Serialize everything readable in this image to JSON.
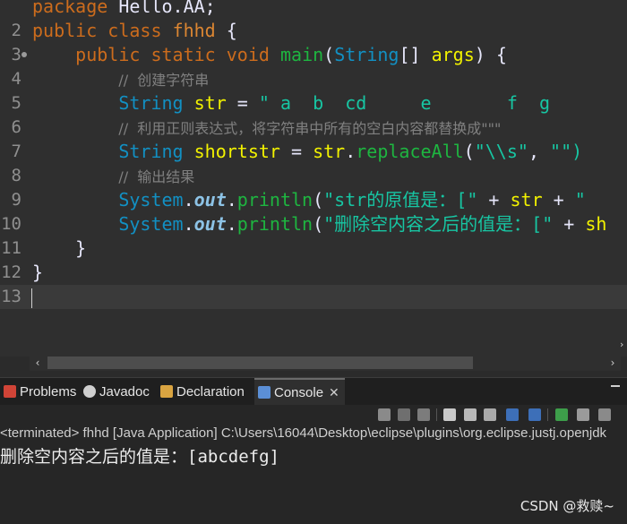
{
  "editor": {
    "lines": [
      {
        "num": "",
        "tokens": [
          {
            "c": "kw",
            "t": "package"
          },
          {
            "c": "plain",
            "t": " Hello.AA;"
          }
        ]
      },
      {
        "num": "2",
        "tokens": [
          {
            "c": "kw",
            "t": "public"
          },
          {
            "c": "plain",
            "t": " "
          },
          {
            "c": "kw",
            "t": "class"
          },
          {
            "c": "plain",
            "t": " "
          },
          {
            "c": "cls",
            "t": "fhhd"
          },
          {
            "c": "plain",
            "t": " {"
          }
        ]
      },
      {
        "num": "3",
        "marker": true,
        "tokens": [
          {
            "c": "plain",
            "t": "    "
          },
          {
            "c": "kw",
            "t": "public"
          },
          {
            "c": "plain",
            "t": " "
          },
          {
            "c": "kw",
            "t": "static"
          },
          {
            "c": "plain",
            "t": " "
          },
          {
            "c": "kw",
            "t": "void"
          },
          {
            "c": "plain",
            "t": " "
          },
          {
            "c": "fn",
            "t": "main"
          },
          {
            "c": "plain",
            "t": "("
          },
          {
            "c": "type",
            "t": "String"
          },
          {
            "c": "plain",
            "t": "[] "
          },
          {
            "c": "var",
            "t": "args"
          },
          {
            "c": "plain",
            "t": ") {"
          }
        ]
      },
      {
        "num": "4",
        "tokens": [
          {
            "c": "plain",
            "t": "        "
          },
          {
            "c": "cmt",
            "t": "//  创建字符串"
          }
        ]
      },
      {
        "num": "5",
        "tokens": [
          {
            "c": "plain",
            "t": "        "
          },
          {
            "c": "type",
            "t": "String"
          },
          {
            "c": "plain",
            "t": " "
          },
          {
            "c": "var",
            "t": "str"
          },
          {
            "c": "plain",
            "t": " = "
          },
          {
            "c": "str",
            "t": "\" a  b  cd     e       f  g"
          }
        ]
      },
      {
        "num": "6",
        "tokens": [
          {
            "c": "plain",
            "t": "        "
          },
          {
            "c": "cmt",
            "t": "//  利用正则表达式，将字符串中所有的空白内容都替换成\"\"\""
          }
        ]
      },
      {
        "num": "7",
        "tokens": [
          {
            "c": "plain",
            "t": "        "
          },
          {
            "c": "type",
            "t": "String"
          },
          {
            "c": "plain",
            "t": " "
          },
          {
            "c": "var",
            "t": "shortstr"
          },
          {
            "c": "plain",
            "t": " = "
          },
          {
            "c": "var",
            "t": "str"
          },
          {
            "c": "plain",
            "t": "."
          },
          {
            "c": "fn",
            "t": "replaceAll"
          },
          {
            "c": "plain",
            "t": "("
          },
          {
            "c": "str",
            "t": "\"\\\\s\""
          },
          {
            "c": "plain",
            "t": ", "
          },
          {
            "c": "str",
            "t": "\"\")"
          }
        ]
      },
      {
        "num": "8",
        "tokens": [
          {
            "c": "plain",
            "t": "        "
          },
          {
            "c": "cmt",
            "t": "//  输出结果"
          }
        ]
      },
      {
        "num": "9",
        "tokens": [
          {
            "c": "plain",
            "t": "        "
          },
          {
            "c": "type",
            "t": "System"
          },
          {
            "c": "plain",
            "t": "."
          },
          {
            "c": "fld",
            "t": "out"
          },
          {
            "c": "plain",
            "t": "."
          },
          {
            "c": "fn",
            "t": "println"
          },
          {
            "c": "plain",
            "t": "("
          },
          {
            "c": "str",
            "t": "\"str的原值是：[\""
          },
          {
            "c": "plain",
            "t": " + "
          },
          {
            "c": "var",
            "t": "str"
          },
          {
            "c": "plain",
            "t": " + "
          },
          {
            "c": "str",
            "t": "\""
          }
        ]
      },
      {
        "num": "10",
        "tokens": [
          {
            "c": "plain",
            "t": "        "
          },
          {
            "c": "type",
            "t": "System"
          },
          {
            "c": "plain",
            "t": "."
          },
          {
            "c": "fld",
            "t": "out"
          },
          {
            "c": "plain",
            "t": "."
          },
          {
            "c": "fn",
            "t": "println"
          },
          {
            "c": "plain",
            "t": "("
          },
          {
            "c": "str",
            "t": "\"删除空内容之后的值是：[\""
          },
          {
            "c": "plain",
            "t": " + "
          },
          {
            "c": "var",
            "t": "sh"
          }
        ]
      },
      {
        "num": "11",
        "tokens": [
          {
            "c": "plain",
            "t": "    }"
          }
        ]
      },
      {
        "num": "12",
        "tokens": [
          {
            "c": "plain",
            "t": "}"
          }
        ]
      },
      {
        "num": "13",
        "current": true,
        "tokens": []
      }
    ]
  },
  "panel": {
    "tabs": [
      {
        "name": "tab-problems",
        "label": "Problems",
        "icon": "problems-icon",
        "color": "#d04437"
      },
      {
        "name": "tab-javadoc",
        "label": "Javadoc",
        "icon": "at-icon",
        "color": "#cfcfcf"
      },
      {
        "name": "tab-declaration",
        "label": "Declaration",
        "icon": "declaration-icon",
        "color": "#d9a441"
      },
      {
        "name": "tab-console",
        "label": "Console",
        "icon": "console-icon",
        "color": "#5b8fd6",
        "active": true
      }
    ],
    "console_header": "<terminated> fhhd [Java Application] C:\\Users\\16044\\Desktop\\eclipse\\plugins\\org.eclipse.justj.openjdk",
    "console_output": "删除空内容之后的值是：[abcdefg]"
  },
  "watermark": "CSDN @救赎~",
  "colors": {
    "keyword": "#cc6c1d",
    "method": "#1eb540",
    "type": "#1290c3",
    "string": "#17c6a3",
    "comment": "#808080",
    "variable": "#f2f200"
  }
}
